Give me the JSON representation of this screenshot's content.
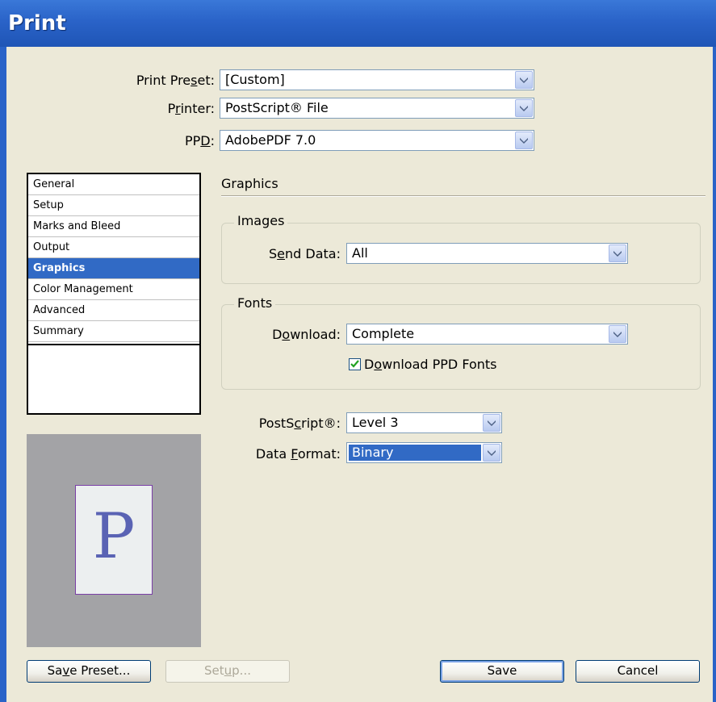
{
  "window": {
    "title": "Print"
  },
  "top": {
    "preset": {
      "label": "Print Preset:",
      "value": "[Custom]"
    },
    "printer": {
      "label": "Printer:",
      "value": "PostScript® File"
    },
    "ppd": {
      "label": "PPD:",
      "value": "AdobePDF 7.0"
    }
  },
  "nav": {
    "items": [
      {
        "label": "General"
      },
      {
        "label": "Setup"
      },
      {
        "label": "Marks and Bleed"
      },
      {
        "label": "Output"
      },
      {
        "label": "Graphics"
      },
      {
        "label": "Color Management"
      },
      {
        "label": "Advanced"
      },
      {
        "label": "Summary"
      }
    ],
    "selected": "Graphics"
  },
  "preview": {
    "letter": "P"
  },
  "graphics": {
    "section_title": "Graphics",
    "images": {
      "group_label": "Images",
      "send_data_label": "Send Data:",
      "send_data_value": "All"
    },
    "fonts": {
      "group_label": "Fonts",
      "download_label": "Download:",
      "download_value": "Complete",
      "ppd_fonts_label": "Download PPD Fonts",
      "ppd_fonts_checked": true
    },
    "postscript": {
      "label": "PostScript®:",
      "value": "Level 3"
    },
    "data_format": {
      "label": "Data Format:",
      "value": "Binary"
    }
  },
  "buttons": {
    "save_preset": "Save Preset...",
    "setup": "Setup...",
    "save": "Save",
    "cancel": "Cancel"
  },
  "colors": {
    "selection": "#316ac5",
    "titlebar": "#2a63c8"
  }
}
